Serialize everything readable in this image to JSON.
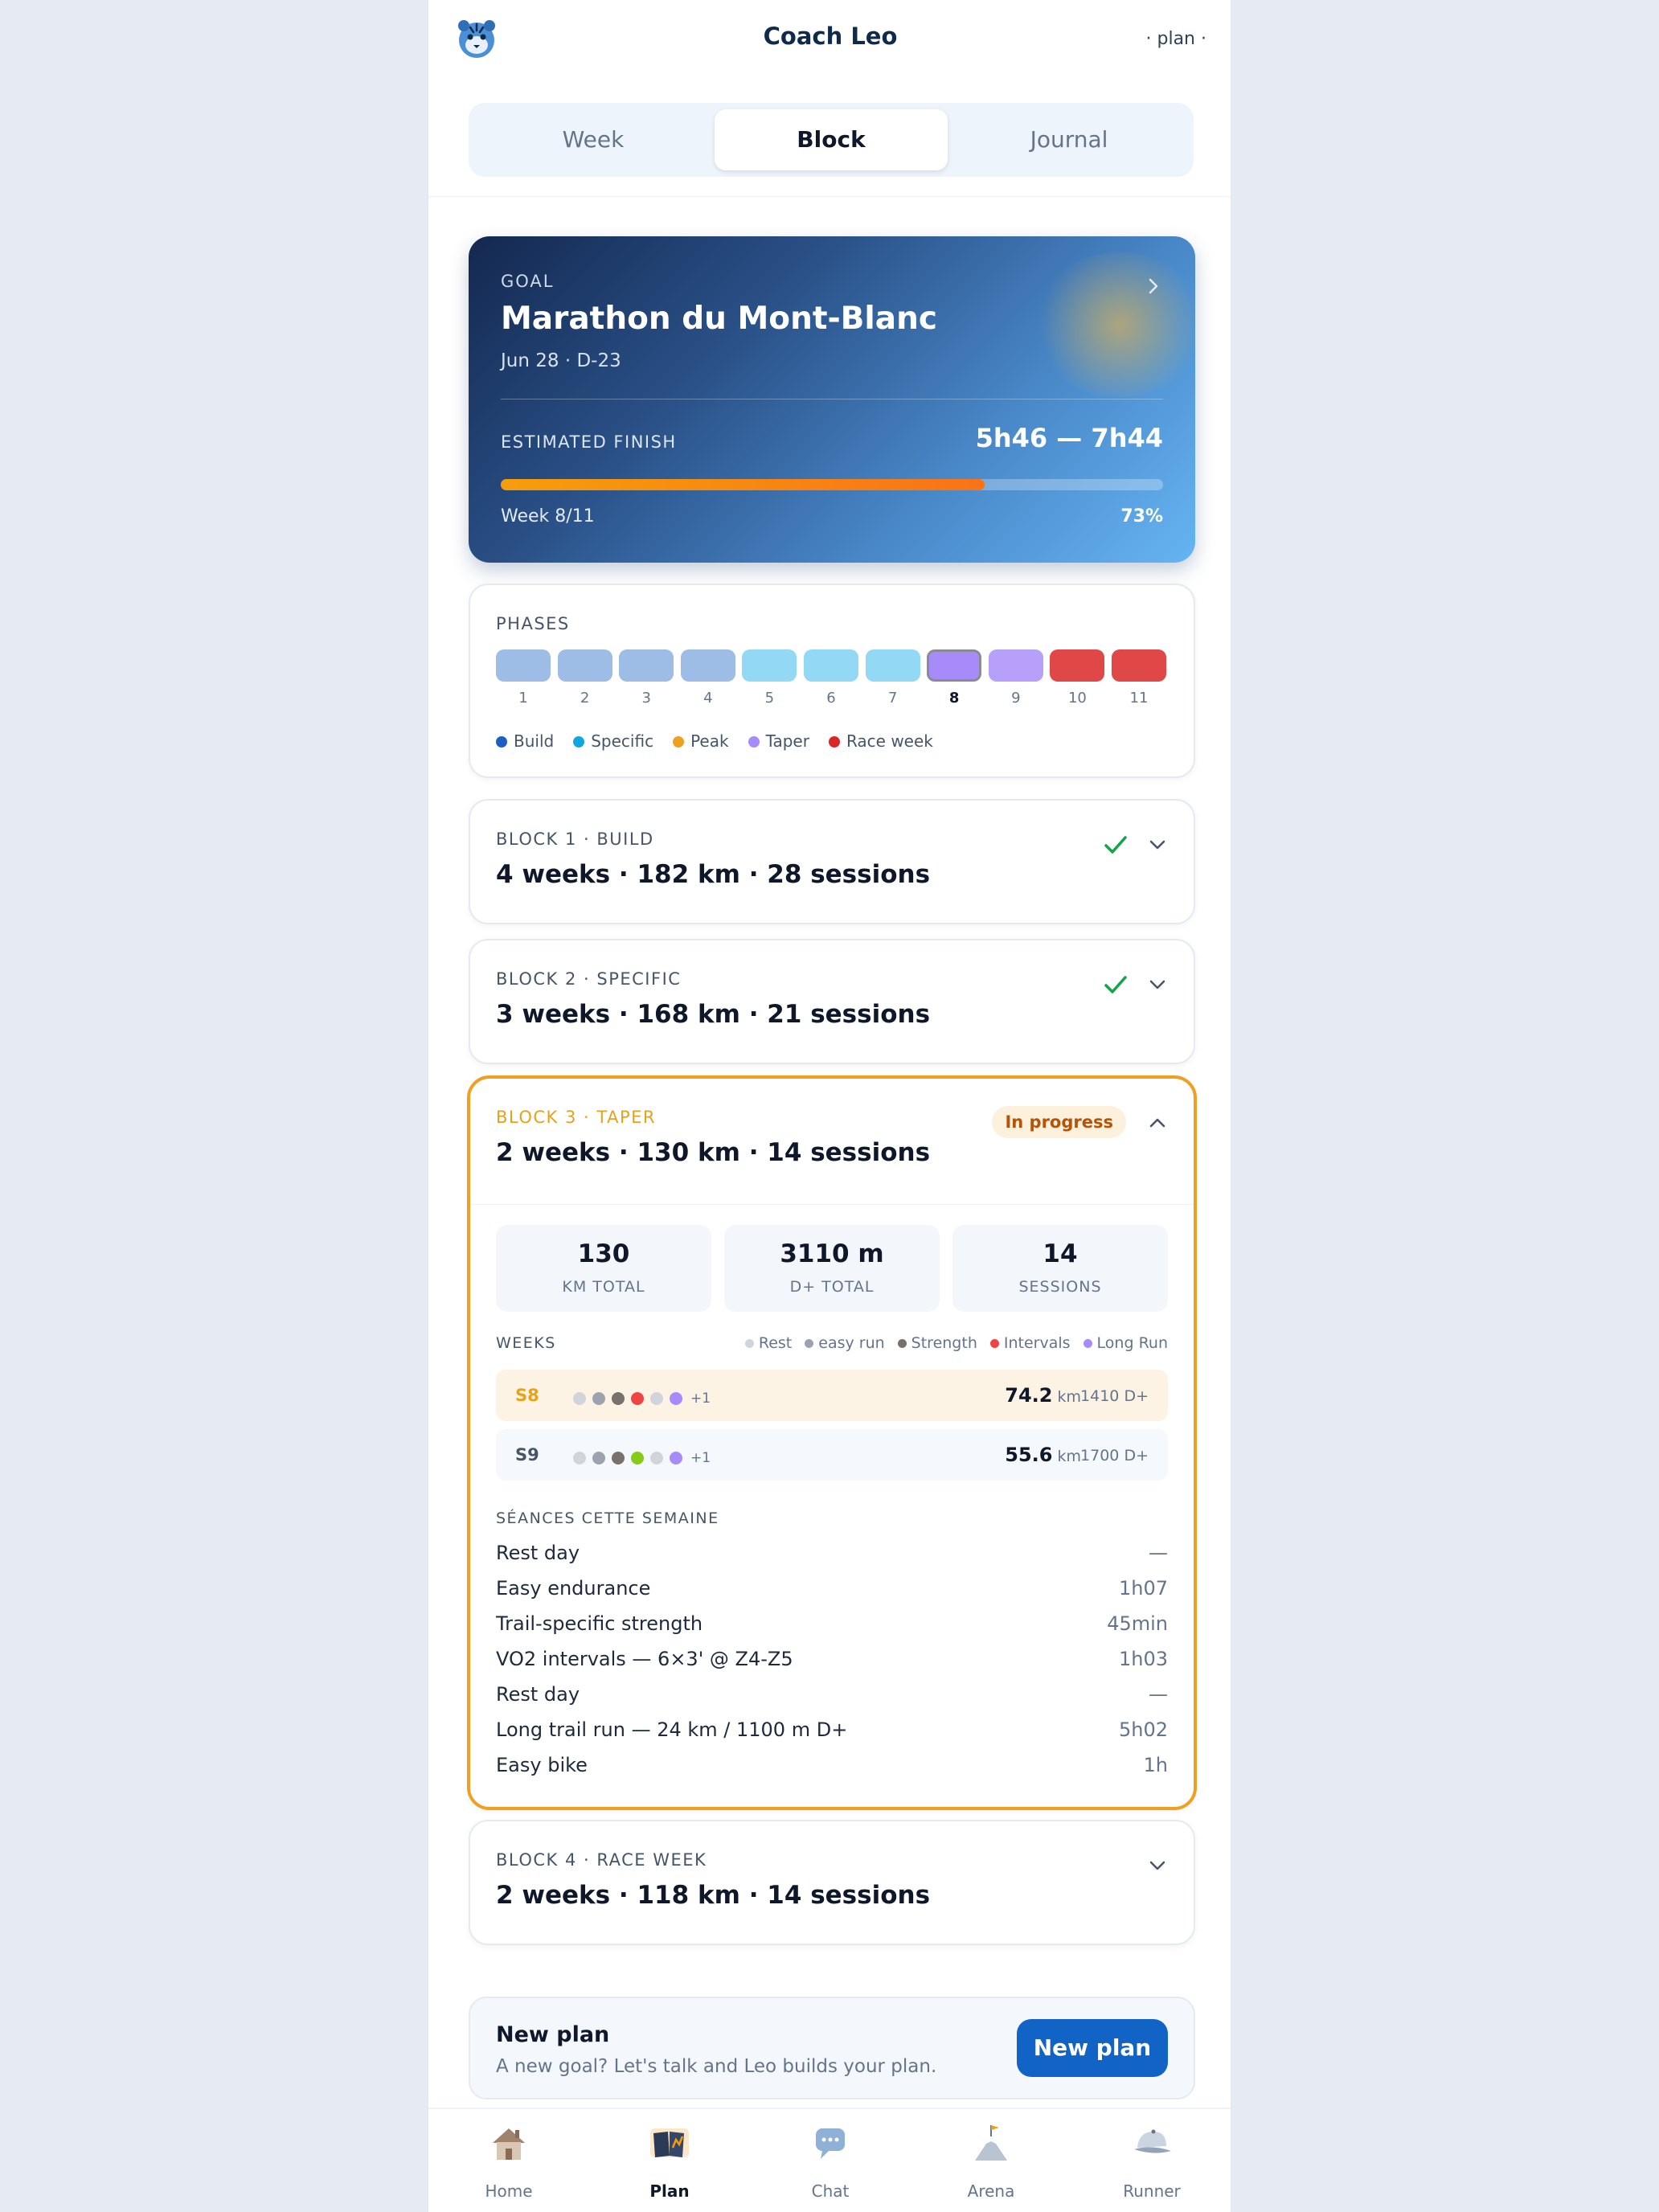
{
  "header": {
    "title": "Coach Leo",
    "menu": "· plan ·"
  },
  "segments": [
    {
      "label": "Week",
      "active": false
    },
    {
      "label": "Block",
      "active": true
    },
    {
      "label": "Journal",
      "active": false
    }
  ],
  "goal": {
    "label": "GOAL",
    "title": "Marathon du Mont-Blanc",
    "subtitle": "Jun 28 · D-23",
    "estimate_label": "ESTIMATED FINISH",
    "estimate_value": "5h46 — 7h44",
    "week_label": "Week 8/11",
    "progress_label": "73%",
    "progress_fraction": 0.73
  },
  "phases": {
    "label": "PHASES",
    "current_week": "8",
    "weeks": [
      {
        "n": "1",
        "color": "#9dbce6"
      },
      {
        "n": "2",
        "color": "#9dbce6"
      },
      {
        "n": "3",
        "color": "#9dbce6"
      },
      {
        "n": "4",
        "color": "#9dbce6"
      },
      {
        "n": "5",
        "color": "#93d8f5"
      },
      {
        "n": "6",
        "color": "#93d8f5"
      },
      {
        "n": "7",
        "color": "#93d8f5"
      },
      {
        "n": "8",
        "color": "#a78bfa"
      },
      {
        "n": "9",
        "color": "#b6a0f9"
      },
      {
        "n": "10",
        "color": "#e04848"
      },
      {
        "n": "11",
        "color": "#e04848"
      }
    ],
    "legend": [
      {
        "label": "Build",
        "color": "#1d5fc0"
      },
      {
        "label": "Specific",
        "color": "#11a6e0"
      },
      {
        "label": "Peak",
        "color": "#f0a020"
      },
      {
        "label": "Taper",
        "color": "#a78bfa"
      },
      {
        "label": "Race week",
        "color": "#dc2626"
      }
    ]
  },
  "blocks": {
    "b1": {
      "label": "BLOCK 1 · BUILD",
      "summary": "4 weeks · 182 km · 28 sessions"
    },
    "b2": {
      "label": "BLOCK 2 · SPECIFIC",
      "summary": "3 weeks · 168 km · 21 sessions"
    },
    "b3": {
      "label": "BLOCK 3 · TAPER",
      "summary": "2 weeks · 130 km · 14 sessions",
      "badge": "In progress",
      "stats": [
        {
          "value": "130",
          "label": "KM TOTAL"
        },
        {
          "value": "3110 m",
          "label": "D+ TOTAL"
        },
        {
          "value": "14",
          "label": "SESSIONS"
        }
      ],
      "weeks_label": "WEEKS",
      "legend": [
        {
          "label": "Rest",
          "color": "#d1d5db"
        },
        {
          "label": "easy run",
          "color": "#9ca3af"
        },
        {
          "label": "Strength",
          "color": "#78716c"
        },
        {
          "label": "Intervals",
          "color": "#ef4444"
        },
        {
          "label": "Long Run",
          "color": "#a78bfa"
        }
      ],
      "weeks": [
        {
          "id": "S8",
          "km": "74.2",
          "unit": "km",
          "dplus": "1410 D+",
          "more": "+1",
          "dots": [
            "#d1d5db",
            "#9ca3af",
            "#78716c",
            "#ef4444",
            "#d1d5db",
            "#a78bfa"
          ]
        },
        {
          "id": "S9",
          "km": "55.6",
          "unit": "km",
          "dplus": "1700 D+",
          "more": "+1",
          "dots": [
            "#d1d5db",
            "#9ca3af",
            "#78716c",
            "#84cc16",
            "#d1d5db",
            "#a78bfa"
          ]
        }
      ],
      "sessions_label": "SÉANCES CETTE SEMAINE",
      "sessions": [
        {
          "name": "Rest day",
          "duration": "—"
        },
        {
          "name": "Easy endurance",
          "duration": "1h07"
        },
        {
          "name": "Trail-specific strength",
          "duration": "45min"
        },
        {
          "name": "VO2 intervals — 6×3' @ Z4-Z5",
          "duration": "1h03"
        },
        {
          "name": "Rest day",
          "duration": "—"
        },
        {
          "name": "Long trail run — 24 km / 1100 m D+",
          "duration": "5h02"
        },
        {
          "name": "Easy bike",
          "duration": "1h"
        }
      ]
    },
    "b4": {
      "label": "BLOCK 4 · RACE WEEK",
      "summary": "2 weeks · 118 km · 14 sessions"
    }
  },
  "new_plan": {
    "title": "New plan",
    "subtitle": "A new goal? Let's talk and Leo builds your plan.",
    "button": "New plan"
  },
  "tabbar": [
    {
      "label": "Home",
      "icon": "house-icon",
      "active": false
    },
    {
      "label": "Plan",
      "icon": "book-icon",
      "active": true
    },
    {
      "label": "Chat",
      "icon": "chat-bubble-icon",
      "active": false
    },
    {
      "label": "Arena",
      "icon": "mountain-flag-icon",
      "active": false
    },
    {
      "label": "Runner",
      "icon": "cap-icon",
      "active": false
    }
  ],
  "colors": {
    "accent": "#1263c6",
    "progress": "#f59e0b",
    "in_progress": "#f0a020",
    "check": "#16a34a"
  }
}
